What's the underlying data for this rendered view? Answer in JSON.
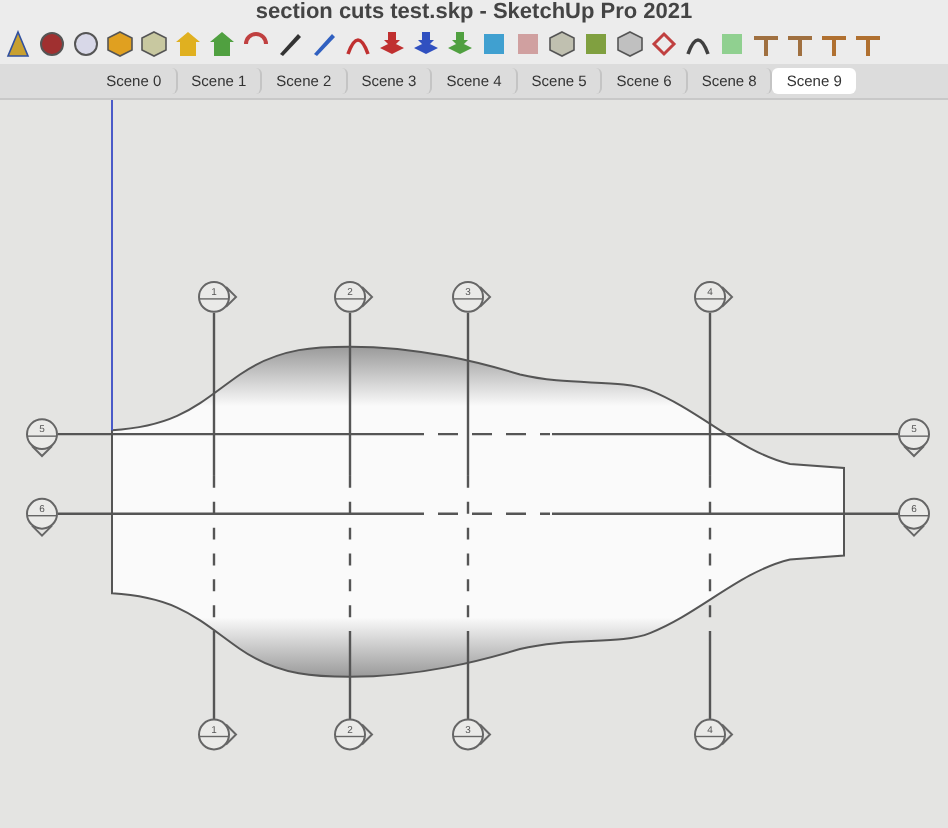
{
  "window": {
    "title": "section cuts test.skp - SketchUp Pro 2021"
  },
  "scenes": [
    {
      "label": "Scene 0",
      "selected": false
    },
    {
      "label": "Scene 1",
      "selected": false
    },
    {
      "label": "Scene 2",
      "selected": false
    },
    {
      "label": "Scene 3",
      "selected": false
    },
    {
      "label": "Scene 4",
      "selected": false
    },
    {
      "label": "Scene 5",
      "selected": false
    },
    {
      "label": "Scene 6",
      "selected": false
    },
    {
      "label": "Scene 8",
      "selected": false
    },
    {
      "label": "Scene 9",
      "selected": true
    }
  ],
  "section_planes": [
    {
      "marker_labels": [
        "1",
        "1"
      ],
      "kind": "vertical"
    },
    {
      "marker_labels": [
        "2",
        "2"
      ],
      "kind": "vertical"
    },
    {
      "marker_labels": [
        "3",
        "3"
      ],
      "kind": "vertical"
    },
    {
      "marker_labels": [
        "4",
        "4"
      ],
      "kind": "vertical"
    },
    {
      "marker_labels": [
        "5",
        "5"
      ],
      "kind": "horizontal"
    },
    {
      "marker_labels": [
        "6",
        "6"
      ],
      "kind": "horizontal"
    }
  ]
}
